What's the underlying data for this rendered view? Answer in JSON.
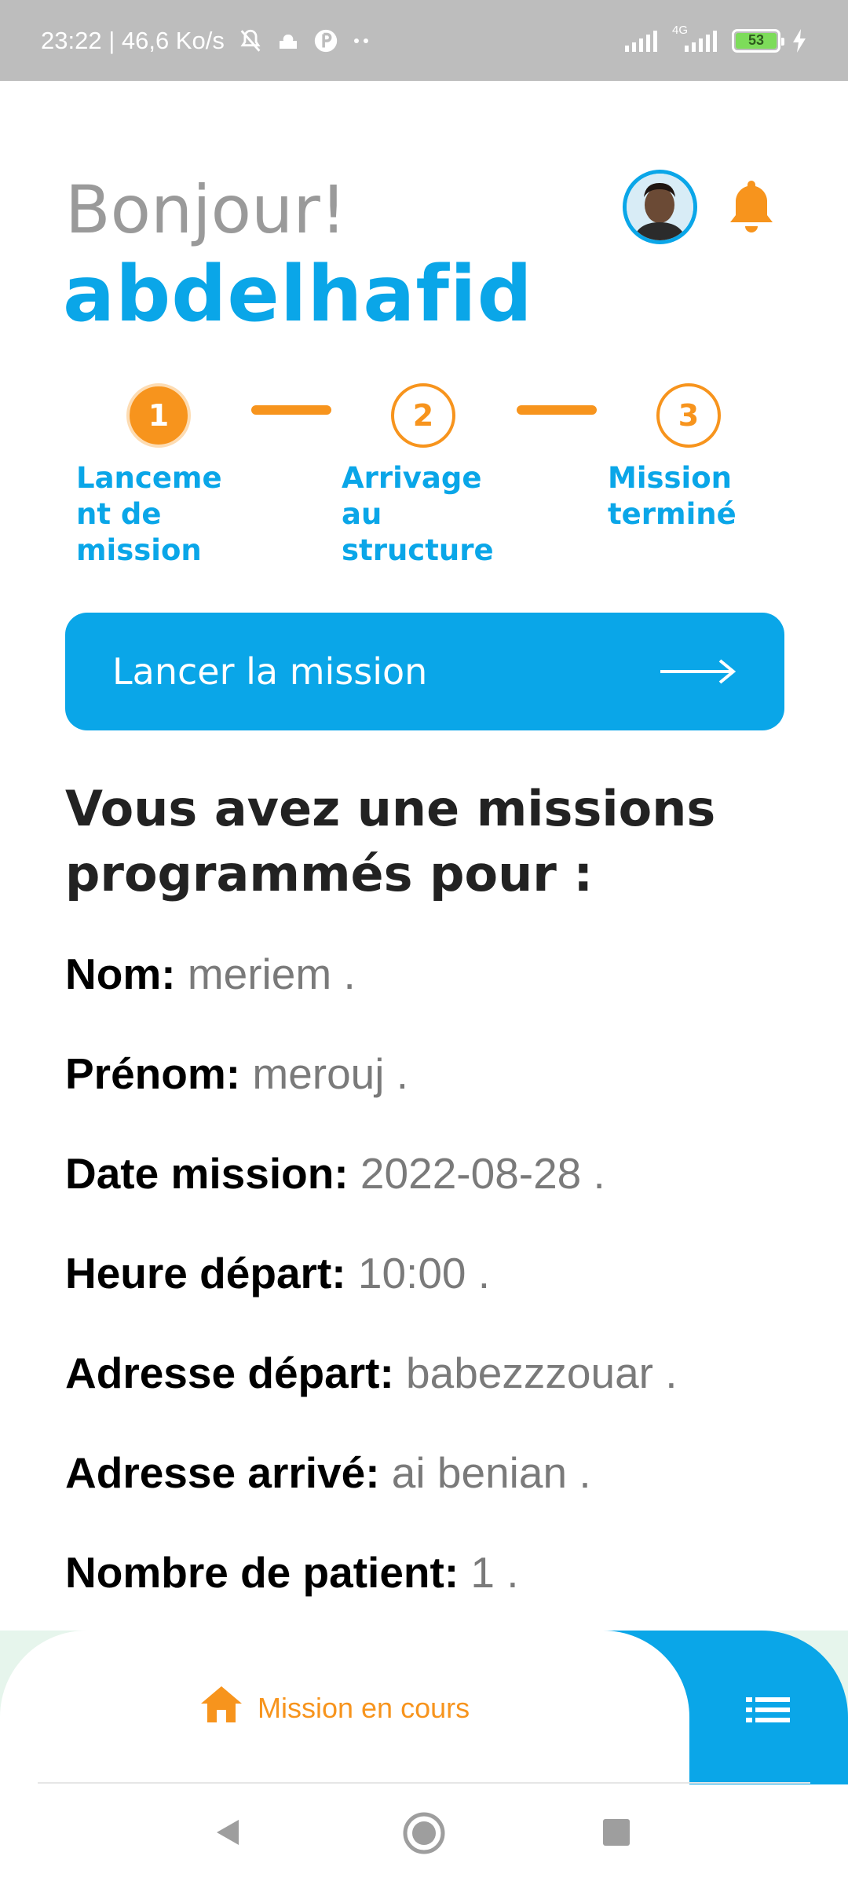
{
  "status_bar": {
    "left_text": "23:22 | 46,6 Ko/s",
    "network_label": "4G",
    "battery_level": "53"
  },
  "header": {
    "greeting": "Bonjour!",
    "username": "abdelhafid"
  },
  "stepper": {
    "steps": [
      {
        "number": "1",
        "label_lines": [
          "Lanceme",
          "nt de",
          "mission"
        ],
        "active": true
      },
      {
        "number": "2",
        "label_lines": [
          "Arrivage",
          "au",
          "structure"
        ],
        "active": false
      },
      {
        "number": "3",
        "label_lines": [
          "Mission",
          "terminé"
        ],
        "active": false
      }
    ]
  },
  "launch_button": {
    "label": "Lancer la mission"
  },
  "missions": {
    "title_line1": "Vous avez une missions",
    "title_line2": "programmés pour :",
    "details": [
      {
        "label": "Nom:",
        "value": " meriem ."
      },
      {
        "label": "Prénom:",
        "value": " merouj ."
      },
      {
        "label": "Date mission:",
        "value": " 2022-08-28 ."
      },
      {
        "label": "Heure départ:",
        "value": " 10:00 ."
      },
      {
        "label": "Adresse départ:",
        "value": " babezzzouar ."
      },
      {
        "label": "Adresse arrivé:",
        "value": " ai benian ."
      },
      {
        "label": "Nombre de patient:",
        "value": " 1 ."
      }
    ]
  },
  "bottom_nav": {
    "home_label": "Mission en cours"
  },
  "colors": {
    "primary_blue": "#0aa6e8",
    "accent_orange": "#f7941d"
  },
  "icons": {
    "home": "home-icon",
    "menu": "list-menu-icon",
    "bell": "bell-icon",
    "arrow": "arrow-right-icon"
  }
}
